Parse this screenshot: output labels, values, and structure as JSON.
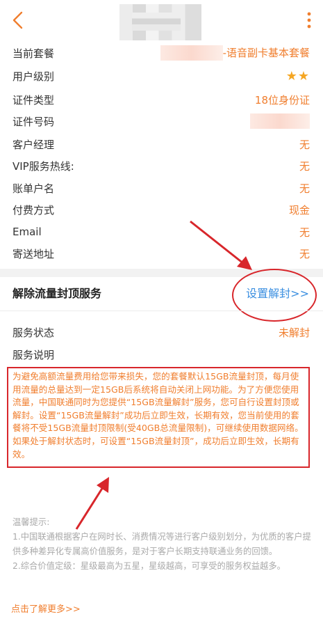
{
  "header": {
    "back_icon": "chevron-left-icon",
    "more_icon": "more-vertical-icon"
  },
  "info_rows": [
    {
      "label": "当前套餐",
      "value": "-语音副卡基本套餐"
    },
    {
      "label": "用户级别",
      "value": "★★"
    },
    {
      "label": "证件类型",
      "value": "18位身份证"
    },
    {
      "label": "证件号码",
      "value": ""
    },
    {
      "label": "客户经理",
      "value": "无"
    },
    {
      "label": "VIP服务热线:",
      "value": "无"
    },
    {
      "label": "账单户名",
      "value": "无"
    },
    {
      "label": "付费方式",
      "value": "现金"
    },
    {
      "label": "Email",
      "value": "无"
    },
    {
      "label": "寄送地址",
      "value": "无"
    }
  ],
  "flow_cap": {
    "title": "解除流量封顶服务",
    "action_label": "设置解封>>",
    "status_label": "服务状态",
    "status_value": "未解封",
    "desc_label": "服务说明",
    "description": "为避免高额流量费用给您带来损失，您的套餐默认15GB流量封顶，每月使用流量的总量达到一定15GB后系统将自动关闭上网功能。为了方便您使用流量，中国联通同时为您提供“15GB流量解封”服务，您可自行设置封顶或解封。设置“15GB流量解封”成功后立即生效，长期有效，您当前使用的套餐将不受15GB流量封顶限制(受40GB总流量限制)，可继续使用数据网络。如果处于解封状态时，可设置“15GB流量封顶”，成功后立即生效，长期有效。"
  },
  "tips": {
    "title": "温馨提示:",
    "items": [
      "1.中国联通根据客户在网时长、消费情况等进行客户级别划分，为优质的客户提供多种差异化专属高价值服务，是对于客户长期支持联通业务的回馈。",
      "2.综合价值定级：星级最高为五星，星级越高，可享受的服务权益越多。"
    ],
    "learn_more": "点击了解更多>>"
  },
  "colors": {
    "accent": "#f07e2e",
    "link": "#3b8fe0",
    "annotation": "#d8262b"
  }
}
